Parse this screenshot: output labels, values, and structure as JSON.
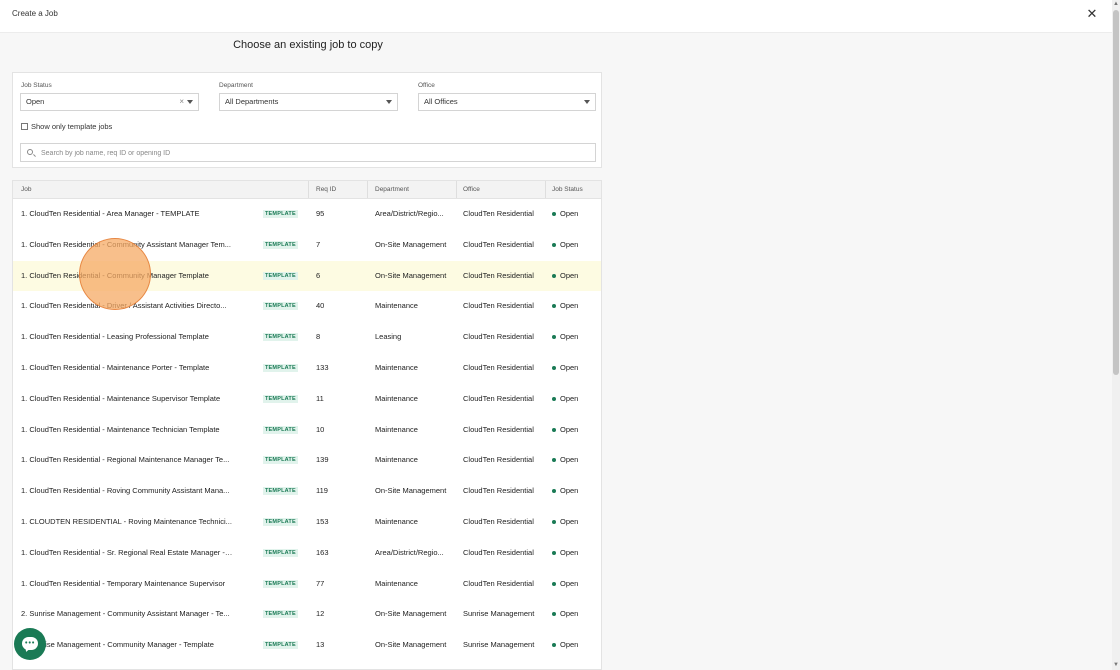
{
  "window": {
    "title": "Create a Job",
    "close_icon": "close-icon"
  },
  "heading": "Choose an existing job to copy",
  "filters": {
    "job_status": {
      "label": "Job Status",
      "value": "Open"
    },
    "department": {
      "label": "Department",
      "value": "All Departments"
    },
    "office": {
      "label": "Office",
      "value": "All Offices"
    },
    "template_only_label": "Show only template jobs",
    "search_placeholder": "Search by job name, req ID or opening ID"
  },
  "table": {
    "columns": [
      "Job",
      "Req ID",
      "Department",
      "Office",
      "Job Status"
    ],
    "rows": [
      {
        "job": "1. CloudTen Residential - Area Manager - TEMPLATE",
        "badge": "TEMPLATE",
        "req_id": "95",
        "department": "Area/District/Regio...",
        "office": "CloudTen Residential",
        "status": "Open"
      },
      {
        "job": "1. CloudTen Residential - Community Assistant Manager Tem...",
        "badge": "TEMPLATE",
        "req_id": "7",
        "department": "On-Site Management",
        "office": "CloudTen Residential",
        "status": "Open"
      },
      {
        "job": "1. CloudTen Residential - Community Manager Template",
        "badge": "TEMPLATE",
        "req_id": "6",
        "department": "On-Site Management",
        "office": "CloudTen Residential",
        "status": "Open",
        "highlighted": true
      },
      {
        "job": "1. CloudTen Residential - Driver / Assistant Activities Directo...",
        "badge": "TEMPLATE",
        "req_id": "40",
        "department": "Maintenance",
        "office": "CloudTen Residential",
        "status": "Open"
      },
      {
        "job": "1. CloudTen Residential - Leasing Professional Template",
        "badge": "TEMPLATE",
        "req_id": "8",
        "department": "Leasing",
        "office": "CloudTen Residential",
        "status": "Open"
      },
      {
        "job": "1. CloudTen Residential - Maintenance Porter - Template",
        "badge": "TEMPLATE",
        "req_id": "133",
        "department": "Maintenance",
        "office": "CloudTen Residential",
        "status": "Open"
      },
      {
        "job": "1. CloudTen Residential - Maintenance Supervisor Template",
        "badge": "TEMPLATE",
        "req_id": "11",
        "department": "Maintenance",
        "office": "CloudTen Residential",
        "status": "Open"
      },
      {
        "job": "1. CloudTen Residential - Maintenance Technician Template",
        "badge": "TEMPLATE",
        "req_id": "10",
        "department": "Maintenance",
        "office": "CloudTen Residential",
        "status": "Open"
      },
      {
        "job": "1. CloudTen Residential - Regional Maintenance Manager Te...",
        "badge": "TEMPLATE",
        "req_id": "139",
        "department": "Maintenance",
        "office": "CloudTen Residential",
        "status": "Open"
      },
      {
        "job": "1. CloudTen Residential - Roving Community Assistant Mana...",
        "badge": "TEMPLATE",
        "req_id": "119",
        "department": "On-Site Management",
        "office": "CloudTen Residential",
        "status": "Open"
      },
      {
        "job": "1. CLOUDTEN RESIDENTIAL - Roving Maintenance Technici...",
        "badge": "TEMPLATE",
        "req_id": "153",
        "department": "Maintenance",
        "office": "CloudTen Residential",
        "status": "Open"
      },
      {
        "job": "1. CloudTen Residential - Sr. Regional Real Estate Manager - ...",
        "badge": "TEMPLATE",
        "req_id": "163",
        "department": "Area/District/Regio...",
        "office": "CloudTen Residential",
        "status": "Open"
      },
      {
        "job": "1. CloudTen Residential - Temporary Maintenance Supervisor",
        "badge": "TEMPLATE",
        "req_id": "77",
        "department": "Maintenance",
        "office": "CloudTen Residential",
        "status": "Open"
      },
      {
        "job": "2. Sunrise Management - Community Assistant Manager - Te...",
        "badge": "TEMPLATE",
        "req_id": "12",
        "department": "On-Site Management",
        "office": "Sunrise Management",
        "status": "Open"
      },
      {
        "job": "2. Sunrise Management - Community Manager - Template",
        "badge": "TEMPLATE",
        "req_id": "13",
        "department": "On-Site Management",
        "office": "Sunrise Management",
        "status": "Open"
      }
    ]
  },
  "colors": {
    "accent": "#1a7a55",
    "badge_bg": "#e1f3ec",
    "highlight_row": "#fdfbe2"
  }
}
